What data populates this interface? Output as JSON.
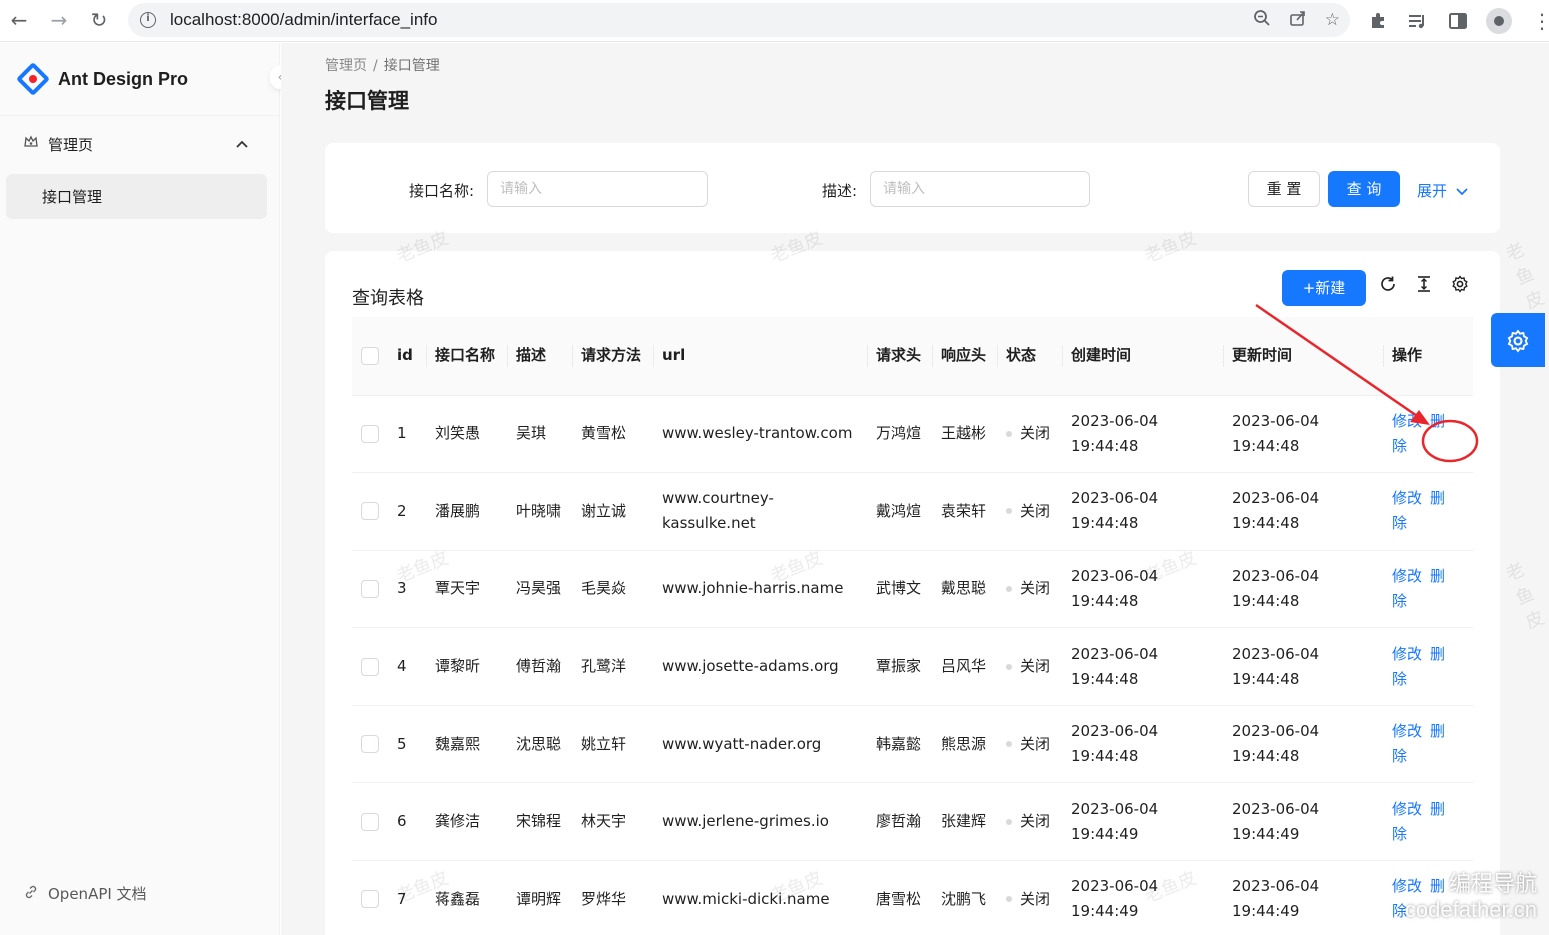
{
  "browser": {
    "url": "localhost:8000/admin/interface_info"
  },
  "sidebar": {
    "app_title": "Ant Design Pro",
    "group_label": "管理页",
    "active_item": "接口管理",
    "footer_link": "OpenAPI 文档"
  },
  "header": {
    "breadcrumb": [
      "管理页",
      "接口管理"
    ],
    "title": "接口管理"
  },
  "search": {
    "name_label": "接口名称:",
    "name_placeholder": "请输入",
    "desc_label": "描述:",
    "desc_placeholder": "请输入",
    "reset_label": "重 置",
    "query_label": "查 询",
    "expand_label": "展开"
  },
  "table": {
    "title": "查询表格",
    "new_label": "+新建",
    "columns": [
      "id",
      "接口名称",
      "描述",
      "请求方法",
      "url",
      "请求头",
      "响应头",
      "状态",
      "创建时间",
      "更新时间",
      "操作"
    ],
    "rows": [
      {
        "id": "1",
        "name": "刘笑愚",
        "desc": "吴琪",
        "method": "黄雪松",
        "url": "www.wesley-trantow.com",
        "req": "万鸿煊",
        "res": "王越彬",
        "status": "关闭",
        "created": [
          "2023-06-04",
          "19:44:48"
        ],
        "updated": [
          "2023-06-04",
          "19:44:48"
        ]
      },
      {
        "id": "2",
        "name": "潘展鹏",
        "desc": "叶晓啸",
        "method": "谢立诚",
        "url": "www.courtney-kassulke.net",
        "req": "戴鸿煊",
        "res": "袁荣轩",
        "status": "关闭",
        "created": [
          "2023-06-04",
          "19:44:48"
        ],
        "updated": [
          "2023-06-04",
          "19:44:48"
        ]
      },
      {
        "id": "3",
        "name": "覃天宇",
        "desc": "冯昊强",
        "method": "毛昊焱",
        "url": "www.johnie-harris.name",
        "req": "武博文",
        "res": "戴思聪",
        "status": "关闭",
        "created": [
          "2023-06-04",
          "19:44:48"
        ],
        "updated": [
          "2023-06-04",
          "19:44:48"
        ]
      },
      {
        "id": "4",
        "name": "谭黎昕",
        "desc": "傅哲瀚",
        "method": "孔鹭洋",
        "url": "www.josette-adams.org",
        "req": "覃振家",
        "res": "吕风华",
        "status": "关闭",
        "created": [
          "2023-06-04",
          "19:44:48"
        ],
        "updated": [
          "2023-06-04",
          "19:44:48"
        ]
      },
      {
        "id": "5",
        "name": "魏嘉熙",
        "desc": "沈思聪",
        "method": "姚立轩",
        "url": "www.wyatt-nader.org",
        "req": "韩嘉懿",
        "res": "熊思源",
        "status": "关闭",
        "created": [
          "2023-06-04",
          "19:44:48"
        ],
        "updated": [
          "2023-06-04",
          "19:44:48"
        ]
      },
      {
        "id": "6",
        "name": "龚修洁",
        "desc": "宋锦程",
        "method": "林天宇",
        "url": "www.jerlene-grimes.io",
        "req": "廖哲瀚",
        "res": "张建辉",
        "status": "关闭",
        "created": [
          "2023-06-04",
          "19:44:49"
        ],
        "updated": [
          "2023-06-04",
          "19:44:49"
        ]
      },
      {
        "id": "7",
        "name": "蒋鑫磊",
        "desc": "谭明辉",
        "method": "罗烨华",
        "url": "www.micki-dicki.name",
        "req": "唐雪松",
        "res": "沈鹏飞",
        "status": "关闭",
        "created": [
          "2023-06-04",
          "19:44:49"
        ],
        "updated": [
          "2023-06-04",
          "19:44:49"
        ]
      }
    ],
    "edit_label": "修改",
    "delete_label": "删除"
  },
  "watermark_text": "老鱼皮",
  "corner_watermark": {
    "line1": "编程导航",
    "line2": "codefather.cn"
  },
  "annotation_color": "#e8262b",
  "accent_color": "#1677ff",
  "icons": {
    "back": "arrow-left-icon",
    "forward": "arrow-right-icon",
    "reload": "reload-icon",
    "info": "info-icon",
    "zoom": "zoom-icon",
    "share": "share-icon",
    "star": "star-icon",
    "extensions": "puzzle-icon",
    "media": "media-list-icon",
    "side_panel": "side-panel-icon",
    "profile": "profile-icon",
    "more": "more-vertical-icon",
    "logo": "ant-design-logo-icon",
    "menu_group": "crown-icon",
    "link": "link-icon",
    "refresh": "refresh-icon",
    "density": "column-height-icon",
    "setting": "setting-icon"
  }
}
